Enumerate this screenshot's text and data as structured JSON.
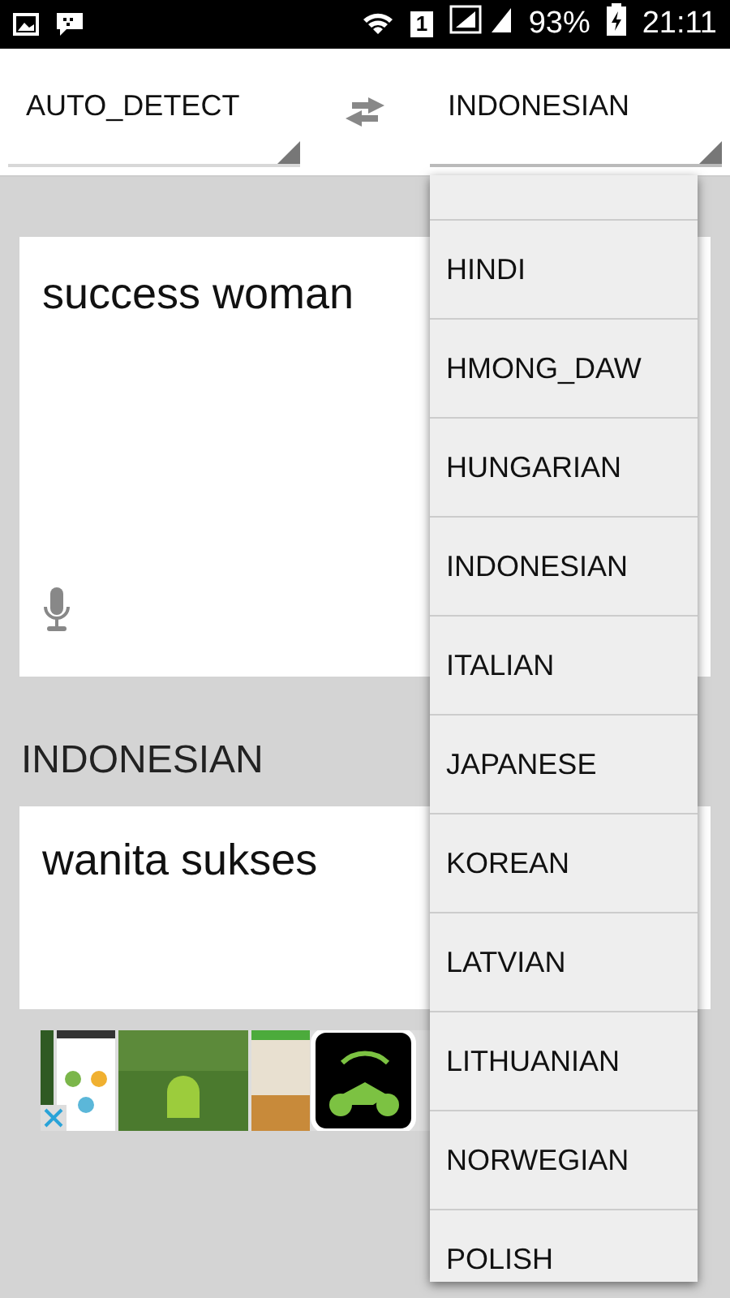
{
  "status_bar": {
    "battery": "93%",
    "time": "21:11",
    "sim": "1"
  },
  "source_language": {
    "value": "AUTO_DETECT"
  },
  "target_language": {
    "value": "INDONESIAN",
    "expanded": true
  },
  "input": {
    "value": "success woman"
  },
  "output_language": "INDONESIAN",
  "output": {
    "value": "wanita sukses"
  },
  "dropdown": {
    "items": [
      {
        "label": "HINDI",
        "selected": false
      },
      {
        "label": "HMONG_DAW",
        "selected": false
      },
      {
        "label": "HUNGARIAN",
        "selected": false
      },
      {
        "label": "INDONESIAN",
        "selected": false
      },
      {
        "label": "ITALIAN",
        "selected": false
      },
      {
        "label": "JAPANESE",
        "selected": false
      },
      {
        "label": "KOREAN",
        "selected": false
      },
      {
        "label": "LATVIAN",
        "selected": false
      },
      {
        "label": "LITHUANIAN",
        "selected": false
      },
      {
        "label": "NORWEGIAN",
        "selected": false
      },
      {
        "label": "POLISH",
        "selected": false
      }
    ]
  }
}
